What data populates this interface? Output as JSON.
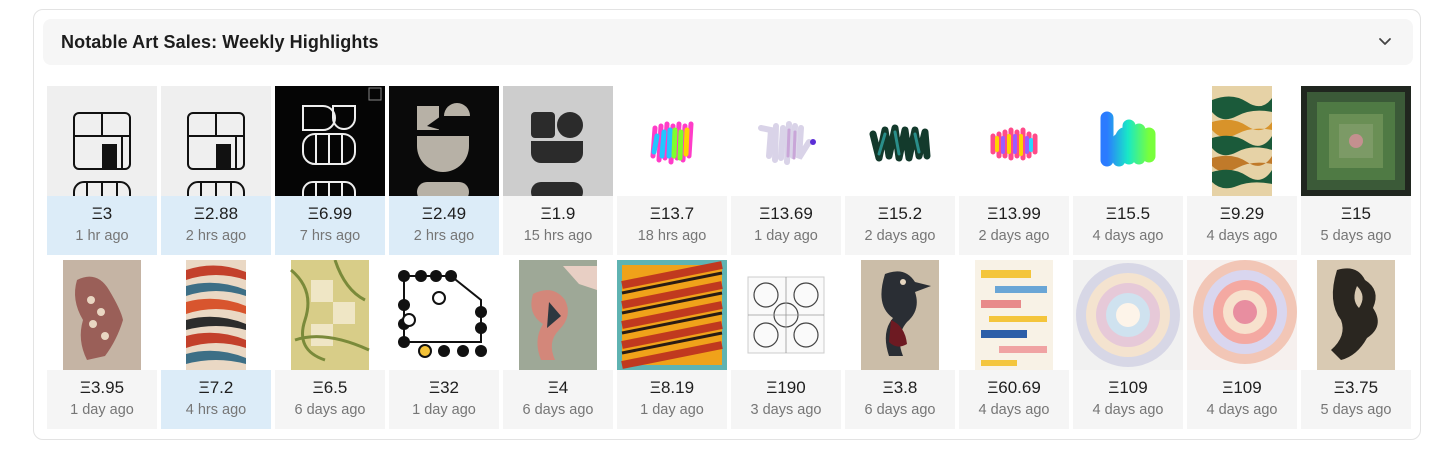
{
  "header": {
    "title": "Notable Art Sales: Weekly Highlights",
    "toggle_icon": "chevron-down-icon"
  },
  "colors": {
    "highlight": "#dcecf8",
    "tile_bg": "#f5f5f5",
    "header_bg": "#f6f6f6"
  },
  "rows": [
    {
      "tiles": [
        {
          "price": "Ξ3",
          "time": "1 hr ago",
          "highlighted": true,
          "art": "grid-glyph-light"
        },
        {
          "price": "Ξ2.88",
          "time": "2 hrs ago",
          "highlighted": true,
          "art": "grid-glyph-light"
        },
        {
          "price": "Ξ6.99",
          "time": "7 hrs ago",
          "highlighted": true,
          "art": "glyph-dark-outline"
        },
        {
          "price": "Ξ2.49",
          "time": "2 hrs ago",
          "highlighted": true,
          "art": "glyph-dark-solid"
        },
        {
          "price": "Ξ1.9",
          "time": "15 hrs ago",
          "highlighted": false,
          "art": "glyph-gray"
        },
        {
          "price": "Ξ13.7",
          "time": "18 hrs ago",
          "highlighted": false,
          "art": "scribble-rainbow"
        },
        {
          "price": "Ξ13.69",
          "time": "1 day ago",
          "highlighted": false,
          "art": "scribble-pastel"
        },
        {
          "price": "Ξ15.2",
          "time": "2 days ago",
          "highlighted": false,
          "art": "scribble-dark"
        },
        {
          "price": "Ξ13.99",
          "time": "2 days ago",
          "highlighted": false,
          "art": "scribble-rainbow-small"
        },
        {
          "price": "Ξ15.5",
          "time": "4 days ago",
          "highlighted": false,
          "art": "scribble-gradient"
        },
        {
          "price": "Ξ9.29",
          "time": "4 days ago",
          "highlighted": false,
          "art": "waves-green"
        },
        {
          "price": "Ξ15",
          "time": "5 days ago",
          "highlighted": false,
          "art": "nested-squares"
        }
      ]
    },
    {
      "tiles": [
        {
          "price": "Ξ3.95",
          "time": "1 day ago",
          "highlighted": false,
          "art": "figure-pattern"
        },
        {
          "price": "Ξ7.2",
          "time": "4 hrs ago",
          "highlighted": true,
          "art": "waves-red"
        },
        {
          "price": "Ξ6.5",
          "time": "6 days ago",
          "highlighted": false,
          "art": "marble-grid"
        },
        {
          "price": "Ξ32",
          "time": "1 day ago",
          "highlighted": false,
          "art": "dots-path"
        },
        {
          "price": "Ξ4",
          "time": "6 days ago",
          "highlighted": false,
          "art": "figure-teal"
        },
        {
          "price": "Ξ8.19",
          "time": "1 day ago",
          "highlighted": false,
          "art": "diagonal-orange"
        },
        {
          "price": "Ξ190",
          "time": "3 days ago",
          "highlighted": false,
          "art": "circle-tiles"
        },
        {
          "price": "Ξ3.8",
          "time": "6 days ago",
          "highlighted": false,
          "art": "figure-bird"
        },
        {
          "price": "Ξ60.69",
          "time": "4 days ago",
          "highlighted": false,
          "art": "bars-colorful"
        },
        {
          "price": "Ξ109",
          "time": "4 days ago",
          "highlighted": false,
          "art": "rings-pastel"
        },
        {
          "price": "Ξ109",
          "time": "4 days ago",
          "highlighted": false,
          "art": "rings-warm"
        },
        {
          "price": "Ξ3.75",
          "time": "5 days ago",
          "highlighted": false,
          "art": "figure-dark"
        }
      ]
    }
  ]
}
